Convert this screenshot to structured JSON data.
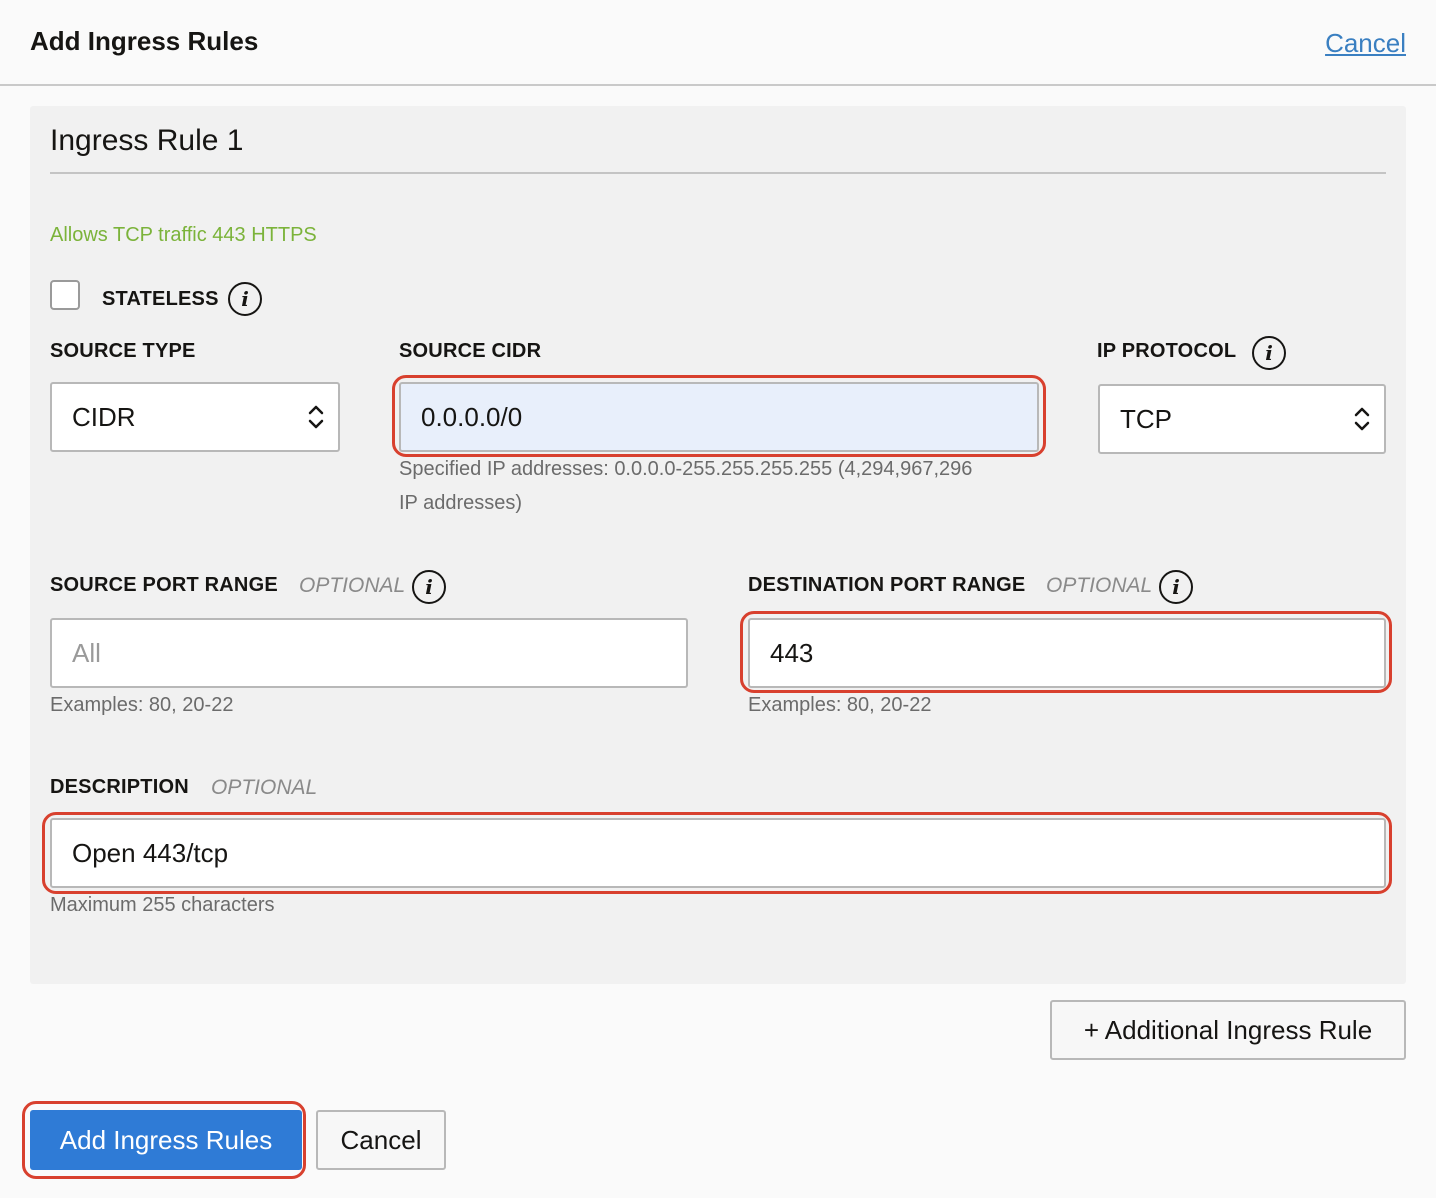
{
  "header": {
    "title": "Add Ingress Rules",
    "cancel_link": "Cancel"
  },
  "rule": {
    "title": "Ingress Rule 1",
    "description_text": "Allows TCP traffic 443 HTTPS",
    "stateless": {
      "label": "STATELESS",
      "checked": false,
      "info_icon": "info-icon"
    },
    "source_type": {
      "label": "SOURCE TYPE",
      "value": "CIDR",
      "icon": "chevron-updown-icon"
    },
    "source_cidr": {
      "label": "SOURCE CIDR",
      "value": "0.0.0.0/0",
      "help_line1": "Specified IP addresses: 0.0.0.0-255.255.255.255 (4,294,967,296",
      "help_line2": "IP addresses)"
    },
    "ip_protocol": {
      "label": "IP PROTOCOL",
      "value": "TCP",
      "info_icon": "info-icon",
      "icon": "chevron-updown-icon"
    },
    "source_port_range": {
      "label": "SOURCE PORT RANGE",
      "optional": "OPTIONAL",
      "placeholder": "All",
      "value": "",
      "help": "Examples: 80, 20-22"
    },
    "destination_port_range": {
      "label": "DESTINATION PORT RANGE",
      "optional": "OPTIONAL",
      "value": "443",
      "help": "Examples: 80, 20-22"
    },
    "description": {
      "label": "DESCRIPTION",
      "optional": "OPTIONAL",
      "value": "Open 443/tcp",
      "help": "Maximum 255 characters"
    }
  },
  "actions": {
    "additional_rule": "+ Additional Ingress Rule",
    "submit": "Add Ingress Rules",
    "cancel": "Cancel"
  },
  "colors": {
    "accent": "#2f7bd6",
    "link": "#3a7fc1",
    "highlight": "#d8402e",
    "success_text": "#7bb33a"
  }
}
